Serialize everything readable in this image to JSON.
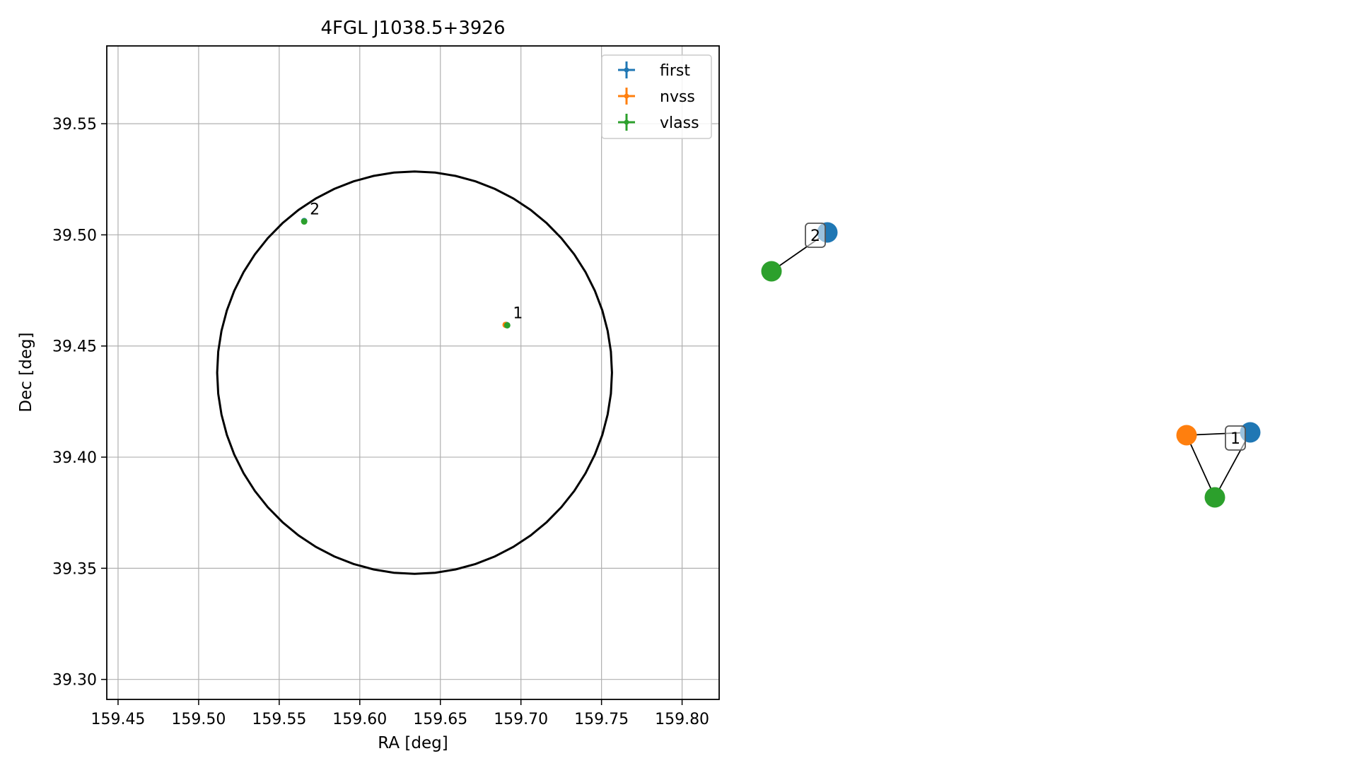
{
  "chart_data": [
    {
      "type": "scatter",
      "title": "4FGL J1038.5+3926",
      "xlabel": "RA [deg]",
      "ylabel": "Dec [deg]",
      "xlim": [
        159.443,
        159.823
      ],
      "ylim": [
        39.291,
        39.585
      ],
      "xticks": [
        159.45,
        159.5,
        159.55,
        159.6,
        159.65,
        159.7,
        159.75,
        159.8
      ],
      "xtick_labels": [
        "159.45",
        "159.50",
        "159.55",
        "159.60",
        "159.65",
        "159.70",
        "159.75",
        "159.80"
      ],
      "yticks": [
        39.3,
        39.35,
        39.4,
        39.45,
        39.5,
        39.55
      ],
      "ytick_labels": [
        "39.30",
        "39.35",
        "39.40",
        "39.45",
        "39.50",
        "39.55"
      ],
      "grid": true,
      "legend_position": "upper right",
      "legend": [
        {
          "name": "first",
          "color": "#1f77b4"
        },
        {
          "name": "nvss",
          "color": "#ff7f0e"
        },
        {
          "name": "vlass",
          "color": "#2ca02c"
        }
      ],
      "ellipse": {
        "center": [
          159.634,
          39.438
        ],
        "ra_half_width": 0.1225,
        "dec_half_height": 0.0905,
        "color": "#000000"
      },
      "sources": [
        {
          "label": "1",
          "points": [
            {
              "catalog": "first",
              "ra": 159.691,
              "dec": 39.4595,
              "color": "#1f77b4"
            },
            {
              "catalog": "nvss",
              "ra": 159.6905,
              "dec": 39.4595,
              "color": "#ff7f0e"
            },
            {
              "catalog": "vlass",
              "ra": 159.6915,
              "dec": 39.4593,
              "color": "#2ca02c"
            }
          ]
        },
        {
          "label": "2",
          "points": [
            {
              "catalog": "first",
              "ra": 159.5655,
              "dec": 39.5062,
              "color": "#1f77b4"
            },
            {
              "catalog": "vlass",
              "ra": 159.5655,
              "dec": 39.506,
              "color": "#2ca02c"
            }
          ]
        }
      ]
    },
    {
      "type": "network",
      "groups": [
        {
          "label": "2",
          "nodes": [
            "first",
            "vlass"
          ],
          "edges": [
            [
              "first",
              "vlass"
            ]
          ]
        },
        {
          "label": "1",
          "nodes": [
            "first",
            "nvss",
            "vlass"
          ],
          "edges": [
            [
              "first",
              "nvss"
            ],
            [
              "nvss",
              "vlass"
            ],
            [
              "vlass",
              "first"
            ]
          ]
        }
      ],
      "node_colors": {
        "first": "#1f77b4",
        "nvss": "#ff7f0e",
        "vlass": "#2ca02c"
      }
    }
  ]
}
